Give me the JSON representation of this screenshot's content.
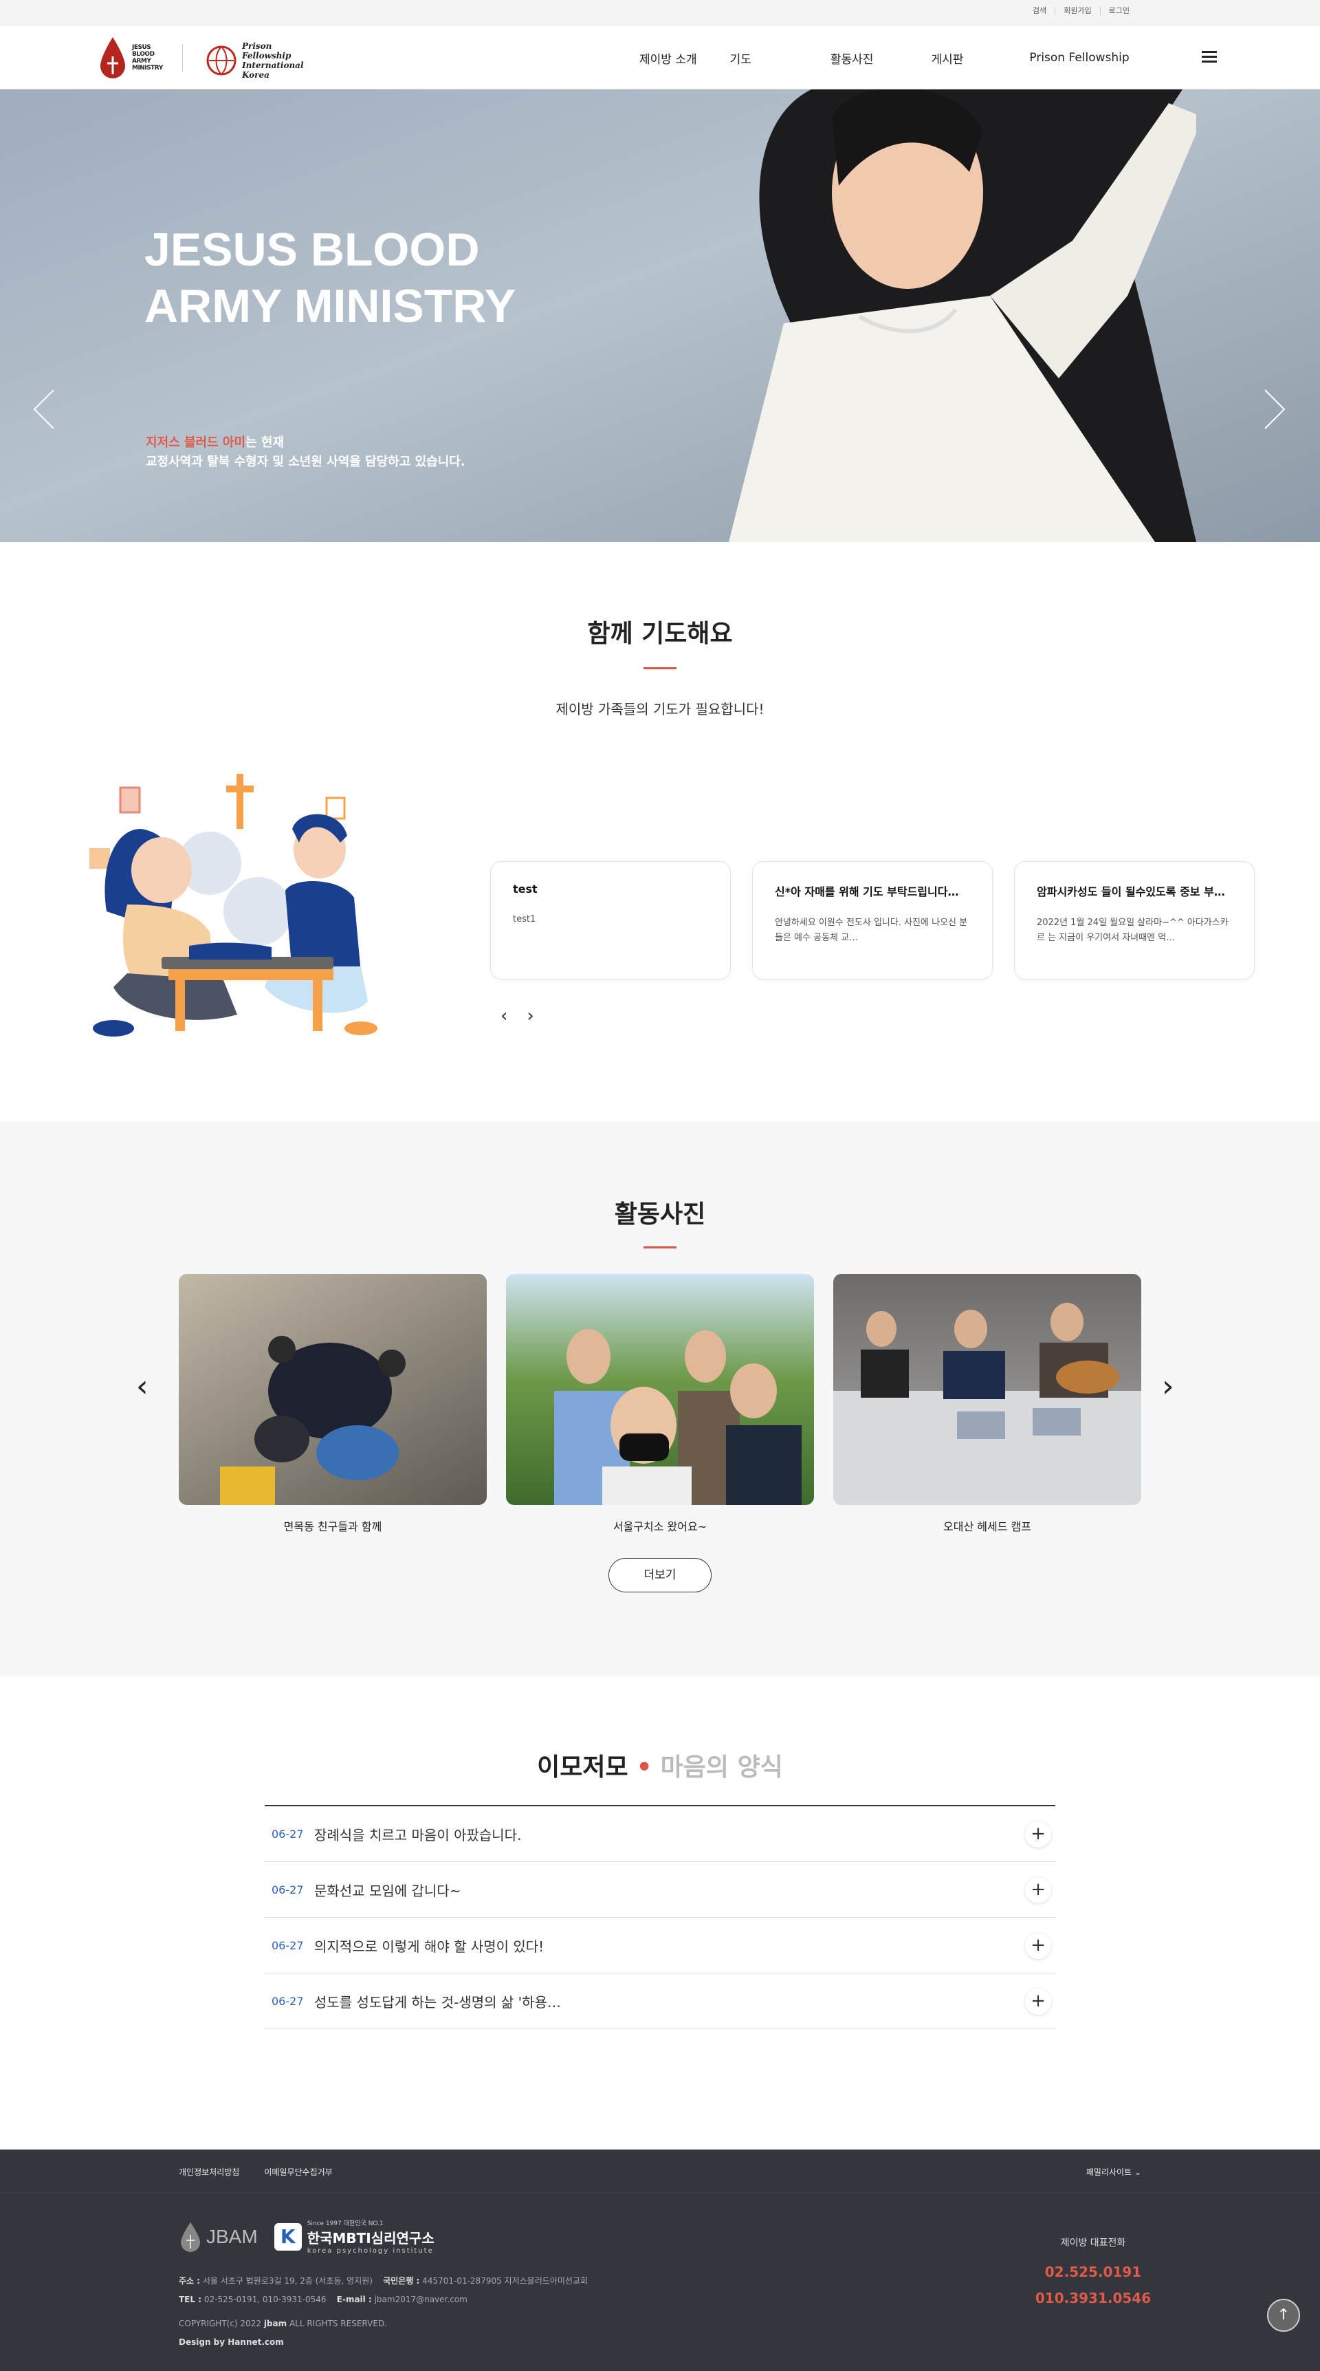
{
  "top_links": [
    "검색",
    "회원가입",
    "로그인"
  ],
  "logo": {
    "jbam": "JESUS BLOOD ARMY MINISTRY",
    "pf": "Prison Fellowship International Korea"
  },
  "nav": [
    "제이방 소개",
    "기도",
    "활동사진",
    "게시판",
    "Prison Fellowship"
  ],
  "hero": {
    "title": "JESUS BLOOD ARMY MINISTRY",
    "sub_accent": "지저스 블러드 아미",
    "sub_rest": "는 현재",
    "sub_line2": "교정사역과 탈북 수형자 및 소년원 사역을 담당하고 있습니다."
  },
  "pray": {
    "title": "함께 기도해요",
    "desc": "제이방 가족들의 기도가 필요합니다!",
    "cards": [
      {
        "title": "test",
        "body": "test1"
      },
      {
        "title": "신*아 자매를 위해 기도 부탁드립니다…",
        "body": "안녕하세요 이원수 전도사 입니다. 사진에 나오신 분들은 예수 공동체 교…"
      },
      {
        "title": "암파시카성도 들이 될수있도록 중보 부…",
        "body": "2022년 1월 24일 월요일 살라마~^^ 아다가스카르 는 지금이 우기여서 자녀때엔 억…"
      }
    ]
  },
  "photos": {
    "title": "활동사진",
    "more": "더보기",
    "items": [
      {
        "caption": "면목동 친구들과 함께"
      },
      {
        "caption": "서울구치소 왔어요~"
      },
      {
        "caption": "오대산 헤세드 캠프"
      }
    ]
  },
  "news": {
    "title_a": "이모저모",
    "title_b": "마음의 양식",
    "items": [
      {
        "date": "06-27",
        "title": "장례식을 치르고 마음이 아팠습니다."
      },
      {
        "date": "06-27",
        "title": "문화선교 모임에 갑니다~"
      },
      {
        "date": "06-27",
        "title": "의지적으로 이렇게 해야 할 사명이 있다!"
      },
      {
        "date": "06-27",
        "title": "성도를 성도답게 하는 것-생명의 삶 '하용…"
      }
    ]
  },
  "footer": {
    "links": [
      "개인정보처리방침",
      "이메일무단수집거부"
    ],
    "family": "패밀리사이트",
    "jbam": "JBAM",
    "kpi_since": "Since 1997 대한민국 NO.1",
    "kpi_name": "한국MBTI심리연구소",
    "kpi_en": "korea psychology institute",
    "addr_label": "주소 :",
    "addr": "서울 서초구 법원로3길 19, 2층 (서초동, 영지원)",
    "bank_label": "국민은행 :",
    "bank": "445701-01-287905 지저스블러드아미선교회",
    "tel_label": "TEL :",
    "tel": "02-525-0191, 010-3931-0546",
    "email_label": "E-mail :",
    "email": "jbam2017@naver.com",
    "copy_a": "COPYRIGHT(c) 2022",
    "copy_brand": "jbam",
    "copy_b": "ALL RIGHTS RESERVED.",
    "design": "Design by Hannet.com",
    "call_label": "제이방 대표전화",
    "phone1": "02.525.0191",
    "phone2": "010.3931.0546"
  },
  "colors": {
    "accent": "#d9554a",
    "date": "#2a61b5",
    "footer": "#33363c"
  }
}
